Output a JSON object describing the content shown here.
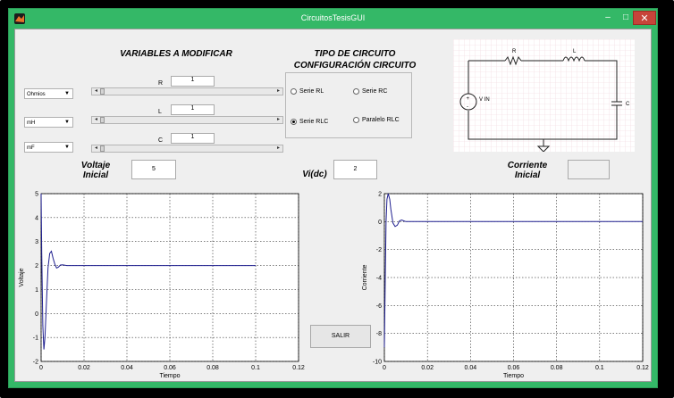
{
  "window": {
    "title": "CircuitosTesisGUI",
    "minimize": "–",
    "maximize": "□",
    "close": "✕"
  },
  "headings": {
    "variables": "VARIABLES A MODIFICAR",
    "tipo_line1": "TIPO DE CIRCUITO",
    "tipo_line2": "CONFIGURACIÓN CIRCUITO"
  },
  "units": [
    {
      "label": "R",
      "unit": "Ohmios",
      "value": "1"
    },
    {
      "label": "L",
      "unit": "mH",
      "value": "1"
    },
    {
      "label": "C",
      "unit": "mF",
      "value": "1"
    }
  ],
  "circuit_options": [
    {
      "label": "Serie RL",
      "selected": false
    },
    {
      "label": "Serie RC",
      "selected": false
    },
    {
      "label": "Serie RLC",
      "selected": true
    },
    {
      "label": "Paralelo RLC",
      "selected": false
    }
  ],
  "schematic": {
    "r_label": "R",
    "l_label": "L",
    "c_label": "C",
    "source_label": "V IN",
    "plus": "+",
    "minus": "-"
  },
  "voltaje_inicial": {
    "label_line1": "Voltaje",
    "label_line2": "Inicial",
    "value": "5"
  },
  "vi_dc": {
    "label": "Vi(dc)",
    "value": "2"
  },
  "corriente_inicial": {
    "label_line1": "Corriente",
    "label_line2": "Inicial",
    "value": ""
  },
  "salir_button": "SALIR",
  "chart_data": [
    {
      "type": "line",
      "title": "",
      "xlabel": "Tiempo",
      "ylabel": "Voltaje",
      "xlim": [
        0,
        0.12
      ],
      "ylim": [
        -2,
        5
      ],
      "xticks": [
        "0",
        "0.02",
        "0.04",
        "0.06",
        "0.08",
        "0.1",
        "0.12"
      ],
      "yticks": [
        "-2",
        "-1",
        "0",
        "1",
        "2",
        "3",
        "4",
        "5"
      ],
      "grid": true,
      "series": [
        {
          "color": "#1f1f8f",
          "x": [
            0,
            0.0003,
            0.0008,
            0.0013,
            0.0018,
            0.0025,
            0.0032,
            0.004,
            0.0048,
            0.0056,
            0.0064,
            0.0072,
            0.008,
            0.009,
            0.01,
            0.012,
            0.014,
            0.02,
            0.04,
            0.06,
            0.08,
            0.1
          ],
          "y": [
            5,
            2.5,
            -0.5,
            -1.5,
            -1.0,
            0.5,
            1.9,
            2.5,
            2.6,
            2.3,
            2.05,
            1.9,
            1.93,
            2.02,
            2.03,
            2.0,
            2.0,
            2.0,
            2.0,
            2.0,
            2.0,
            2.0
          ]
        }
      ]
    },
    {
      "type": "line",
      "title": "",
      "xlabel": "Tiempo",
      "ylabel": "Corriente",
      "xlim": [
        0,
        0.12
      ],
      "ylim": [
        -10,
        2
      ],
      "xticks": [
        "0",
        "0.02",
        "0.04",
        "0.06",
        "0.08",
        "0.1",
        "0.12"
      ],
      "yticks": [
        "-10",
        "-8",
        "-6",
        "-4",
        "-2",
        "0",
        "2"
      ],
      "grid": true,
      "series": [
        {
          "color": "#1f1f8f",
          "x": [
            0,
            0.0004,
            0.0008,
            0.0012,
            0.0018,
            0.0025,
            0.003,
            0.004,
            0.005,
            0.006,
            0.007,
            0.008,
            0.009,
            0.01,
            0.012,
            0.02,
            0.04,
            0.06,
            0.08,
            0.1,
            0.12
          ],
          "y": [
            -9,
            -4,
            0,
            1.6,
            2.0,
            1.6,
            0.9,
            -0.1,
            -0.35,
            -0.25,
            0.05,
            0.12,
            0.05,
            0,
            0,
            0,
            0,
            0,
            0,
            0,
            0
          ]
        }
      ]
    }
  ]
}
